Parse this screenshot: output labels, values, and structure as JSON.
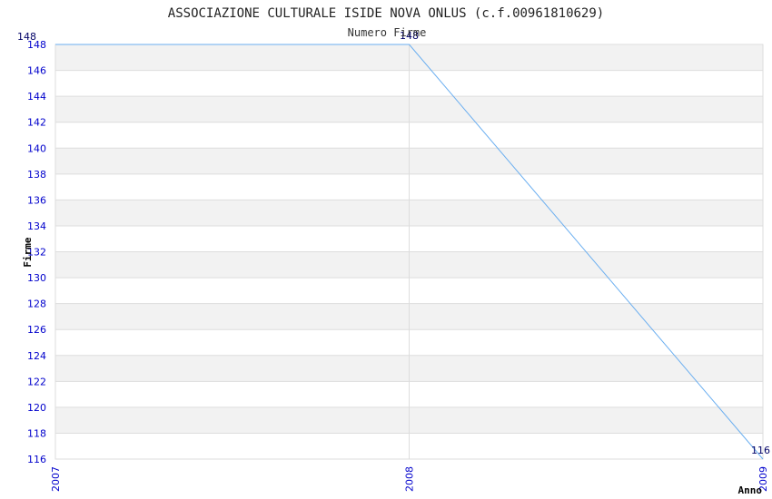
{
  "chart_data": {
    "type": "line",
    "title": "ASSOCIAZIONE CULTURALE ISIDE NOVA ONLUS (c.f.00961810629)",
    "subtitle": "Numero Firme",
    "xlabel": "Anno",
    "ylabel": "Firme",
    "x_ticks": [
      "2007",
      "2008",
      "2009"
    ],
    "y_ticks": [
      "116",
      "118",
      "120",
      "122",
      "124",
      "126",
      "128",
      "130",
      "132",
      "134",
      "136",
      "138",
      "140",
      "142",
      "144",
      "146",
      "148"
    ],
    "xlim": [
      2007,
      2009
    ],
    "ylim": [
      116,
      148
    ],
    "grid": true,
    "series": [
      {
        "x": [
          2007,
          2008,
          2009
        ],
        "values": [
          148,
          148,
          116
        ],
        "labels": [
          "148",
          "148",
          "116"
        ]
      }
    ],
    "colors": {
      "line": "#6aaef0",
      "tick_text": "#0000cc",
      "band": "#f2f2f2",
      "grid": "#dddddd",
      "label_text": "#000066"
    }
  }
}
